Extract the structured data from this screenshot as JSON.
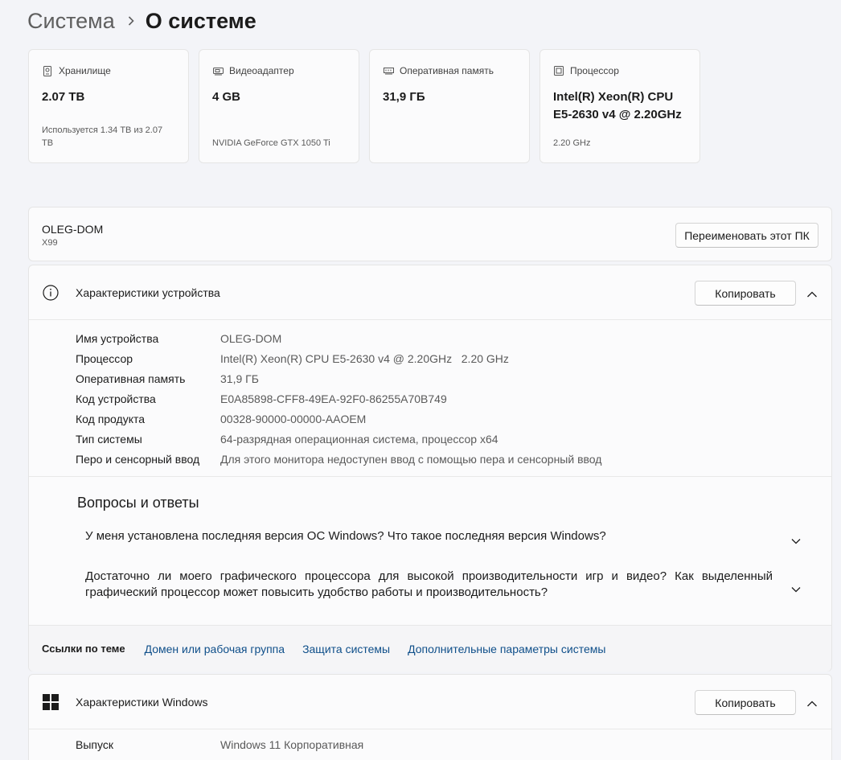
{
  "breadcrumb": {
    "parent": "Система",
    "current": "О системе"
  },
  "cards": [
    {
      "icon": "storage-icon",
      "label": "Хранилище",
      "value": "2.07 TB",
      "sub": "Используется 1.34 TB из 2.07 TB"
    },
    {
      "icon": "gpu-icon",
      "label": "Видеоадаптер",
      "value": "4 GB",
      "sub": "NVIDIA GeForce GTX 1050 Ti"
    },
    {
      "icon": "memory-icon",
      "label": "Оперативная память",
      "value": "31,9 ГБ",
      "sub": ""
    },
    {
      "icon": "cpu-icon",
      "label": "Процессор",
      "value": "Intel(R) Xeon(R) CPU E5-2630 v4 @ 2.20GHz",
      "sub": "2.20 GHz"
    }
  ],
  "pc": {
    "name": "OLEG-DOM",
    "model": "X99",
    "rename_label": "Переименовать этот ПК"
  },
  "device": {
    "title": "Характеристики устройства",
    "copy_label": "Копировать",
    "rows": [
      {
        "label": "Имя устройства",
        "value": "OLEG-DOM"
      },
      {
        "label": "Процессор",
        "value": "Intel(R) Xeon(R) CPU E5-2630 v4 @ 2.20GHz   2.20 GHz"
      },
      {
        "label": "Оперативная память",
        "value": "31,9 ГБ"
      },
      {
        "label": "Код устройства",
        "value": "E0A85898-CFF8-49EA-92F0-86255A70B749"
      },
      {
        "label": "Код продукта",
        "value": "00328-90000-00000-AAOEM"
      },
      {
        "label": "Тип системы",
        "value": "64-разрядная операционная система, процессор x64"
      },
      {
        "label": "Перо и сенсорный ввод",
        "value": "Для этого монитора недоступен ввод с помощью пера и сенсорный ввод"
      }
    ]
  },
  "faq": {
    "title": "Вопросы и ответы",
    "items": [
      "У меня установлена последняя версия ОС Windows? Что такое последняя версия Windows?",
      "Достаточно ли моего графического процессора для высокой производительности игр и видео? Как выделенный графический процессор может повысить удобство работы и производительность?"
    ]
  },
  "links": {
    "label": "Ссылки по теме",
    "items": [
      "Домен или рабочая группа",
      "Защита системы",
      "Дополнительные параметры системы"
    ]
  },
  "windows": {
    "title": "Характеристики Windows",
    "copy_label": "Копировать",
    "rows": [
      {
        "label": "Выпуск",
        "value": "Windows 11 Корпоративная"
      }
    ]
  }
}
